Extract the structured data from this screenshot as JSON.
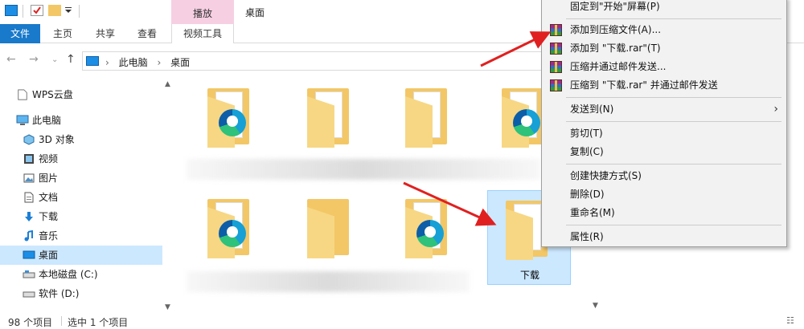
{
  "window": {
    "title": "桌面",
    "context_tab_group": "播放"
  },
  "ribbon": {
    "tabs": [
      "文件",
      "主页",
      "共享",
      "查看",
      "视频工具"
    ]
  },
  "address": {
    "crumbs": [
      "此电脑",
      "桌面"
    ]
  },
  "sidebar": {
    "items": [
      {
        "label": "WPS云盘",
        "icon": "document-icon"
      },
      {
        "label": "此电脑",
        "icon": "computer-icon"
      },
      {
        "label": "3D 对象",
        "icon": "cube-icon"
      },
      {
        "label": "视频",
        "icon": "video-icon"
      },
      {
        "label": "图片",
        "icon": "picture-icon"
      },
      {
        "label": "文档",
        "icon": "document-icon"
      },
      {
        "label": "下载",
        "icon": "download-arrow-icon"
      },
      {
        "label": "音乐",
        "icon": "music-note-icon"
      },
      {
        "label": "桌面",
        "icon": "desktop-icon",
        "selected": true
      },
      {
        "label": "本地磁盘 (C:)",
        "icon": "drive-icon"
      },
      {
        "label": "软件 (D:)",
        "icon": "drive-icon"
      }
    ]
  },
  "content": {
    "selected_item_label": "下载"
  },
  "context_menu": {
    "items": [
      {
        "label": "固定到\"开始\"屏幕(P)",
        "icon": ""
      },
      {
        "label": "添加到压缩文件(A)...",
        "icon": "winrar-icon"
      },
      {
        "label": "添加到 \"下载.rar\"(T)",
        "icon": "winrar-icon"
      },
      {
        "label": "压缩并通过邮件发送...",
        "icon": "winrar-icon"
      },
      {
        "label": "压缩到 \"下载.rar\" 并通过邮件发送",
        "icon": "winrar-icon"
      },
      {
        "label": "发送到(N)",
        "icon": "",
        "submenu": true
      },
      {
        "label": "剪切(T)",
        "icon": ""
      },
      {
        "label": "复制(C)",
        "icon": ""
      },
      {
        "label": "创建快捷方式(S)",
        "icon": ""
      },
      {
        "label": "删除(D)",
        "icon": ""
      },
      {
        "label": "重命名(M)",
        "icon": ""
      },
      {
        "label": "属性(R)",
        "icon": ""
      }
    ]
  },
  "status": {
    "item_count": "98 个项目",
    "selection": "选中 1 个项目"
  },
  "colors": {
    "accent": "#1979ca",
    "selection": "#cce8ff",
    "arrow": "#e02020"
  }
}
